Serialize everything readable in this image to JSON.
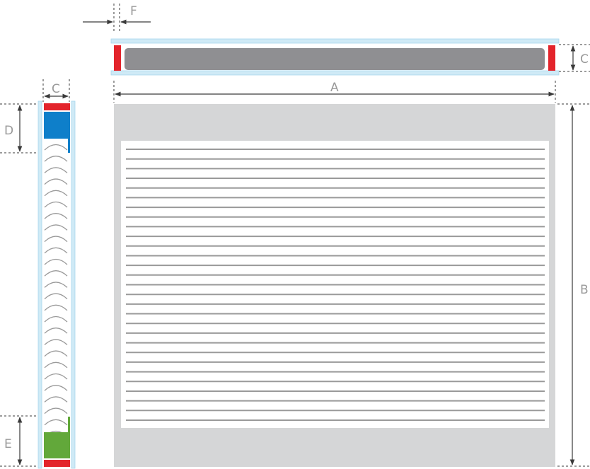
{
  "labels": {
    "a": "A",
    "b": "B",
    "c_top": "C",
    "c_side": "C",
    "d": "D",
    "e": "E",
    "f": "F"
  },
  "colors": {
    "glass": "#cfeaf6",
    "glass_edge": "#a8d8ee",
    "red_stop": "#e3242b",
    "bar": "#8f8f92",
    "panel": "#d5d6d7",
    "sheet": "#ffffff",
    "slat_line": "#9a9a9a",
    "blue": "#0e7fca",
    "green": "#62a83a",
    "dim_line": "#3a3a3a",
    "dim_text": "#9a9a9a"
  },
  "slats": {
    "count": 29
  },
  "arcs": {
    "count": 26
  }
}
